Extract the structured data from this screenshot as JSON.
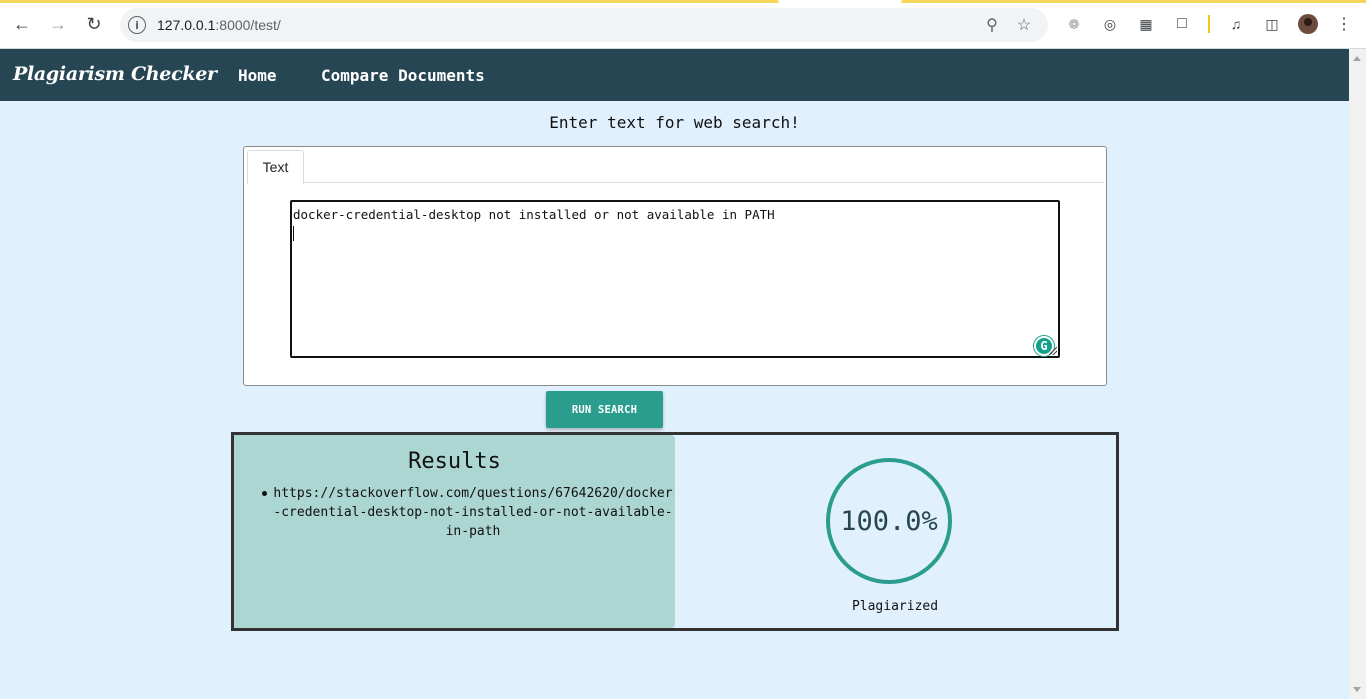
{
  "browser": {
    "url_host": "127.0.0.1",
    "url_path": ":8000/test/",
    "info_icon": "info-icon",
    "back_icon": "back-arrow-icon",
    "forward_icon": "forward-arrow-icon",
    "reload_icon": "reload-icon"
  },
  "navbar": {
    "brand": "Plagiarism Checker",
    "links": [
      "Home",
      "Compare Documents"
    ]
  },
  "main": {
    "heading": "Enter text for web search!",
    "tab_label": "Text",
    "text_value": "docker-credential-desktop not installed or not available in PATH",
    "run_button": "RUN SEARCH"
  },
  "results": {
    "title": "Results",
    "items": [
      "https://stackoverflow.com/questions/67642620/docker-credential-desktop-not-installed-or-not-available-in-path"
    ],
    "percentage": "100.0%",
    "label": "Plagiarized"
  },
  "colors": {
    "navbar": "#264653",
    "accent": "#2a9d8f",
    "results_panel": "#acd6d1",
    "page_bg": "#e1f0fd"
  }
}
